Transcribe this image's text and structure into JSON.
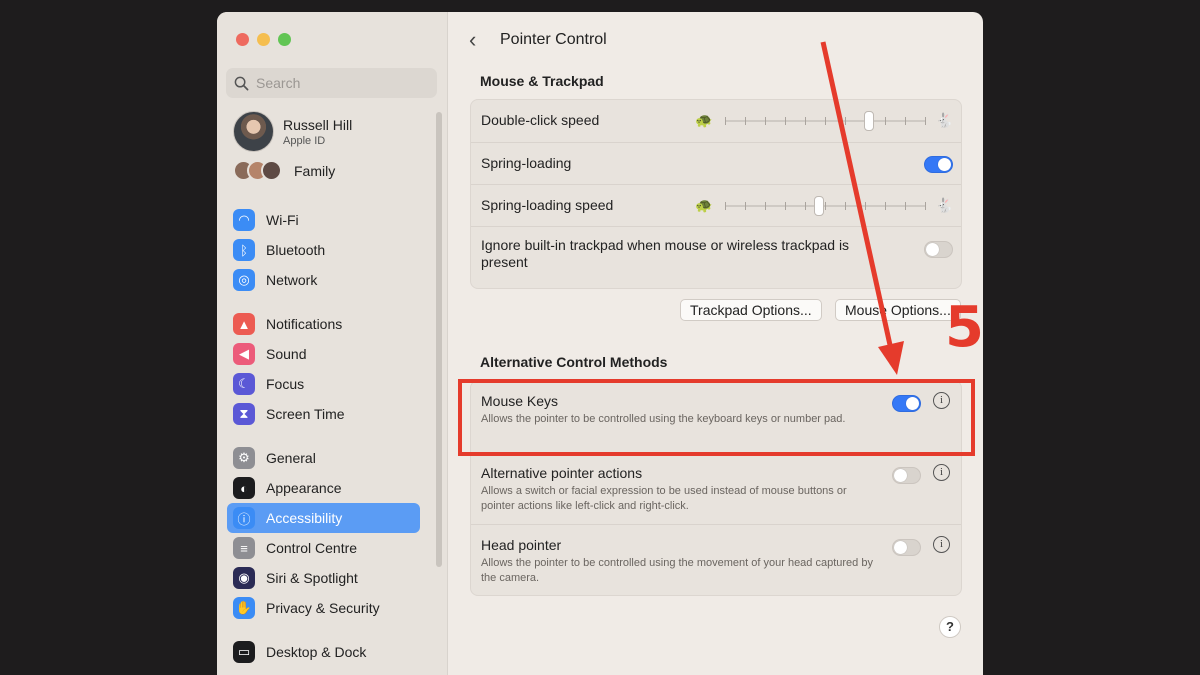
{
  "sidebar": {
    "search_placeholder": "Search",
    "user": {
      "name": "Russell Hill",
      "subtitle": "Apple ID"
    },
    "family_label": "Family",
    "groups": [
      [
        {
          "label": "Wi-Fi",
          "icon": "wifi-icon",
          "color": "#3b8cf5"
        },
        {
          "label": "Bluetooth",
          "icon": "bluetooth-icon",
          "color": "#3b8cf5"
        },
        {
          "label": "Network",
          "icon": "globe-icon",
          "color": "#3b8cf5"
        }
      ],
      [
        {
          "label": "Notifications",
          "icon": "bell-icon",
          "color": "#ec5b52"
        },
        {
          "label": "Sound",
          "icon": "speaker-icon",
          "color": "#ec5b7a"
        },
        {
          "label": "Focus",
          "icon": "moon-icon",
          "color": "#5b58d6"
        },
        {
          "label": "Screen Time",
          "icon": "hourglass-icon",
          "color": "#5b58d6"
        }
      ],
      [
        {
          "label": "General",
          "icon": "gear-icon",
          "color": "#8e8e93"
        },
        {
          "label": "Appearance",
          "icon": "appearance-icon",
          "color": "#1c1c1e"
        },
        {
          "label": "Accessibility",
          "icon": "accessibility-icon",
          "color": "#3b8cf5",
          "active": true
        },
        {
          "label": "Control Centre",
          "icon": "control-centre-icon",
          "color": "#8e8e93"
        },
        {
          "label": "Siri & Spotlight",
          "icon": "siri-icon",
          "color": "#2b2b55"
        },
        {
          "label": "Privacy & Security",
          "icon": "hand-icon",
          "color": "#3b8cf5"
        }
      ],
      [
        {
          "label": "Desktop & Dock",
          "icon": "dock-icon",
          "color": "#1c1c1e"
        }
      ]
    ]
  },
  "main": {
    "title": "Pointer Control",
    "mouse_trackpad": {
      "heading": "Mouse & Trackpad",
      "double_click_speed": {
        "label": "Double-click speed",
        "value": 0.72
      },
      "spring_loading": {
        "label": "Spring-loading",
        "on": true
      },
      "spring_loading_speed": {
        "label": "Spring-loading speed",
        "value": 0.47
      },
      "ignore_trackpad": {
        "label": "Ignore built-in trackpad when mouse or wireless trackpad is present",
        "on": false
      }
    },
    "buttons": {
      "trackpad_options": "Trackpad Options...",
      "mouse_options": "Mouse Options..."
    },
    "alternative": {
      "heading": "Alternative Control Methods",
      "items": [
        {
          "label": "Mouse Keys",
          "desc": "Allows the pointer to be controlled using the keyboard keys or number pad.",
          "on": true
        },
        {
          "label": "Alternative pointer actions",
          "desc": "Allows a switch or facial expression to be used instead of mouse buttons or pointer actions like left-click and right-click.",
          "on": false
        },
        {
          "label": "Head pointer",
          "desc": "Allows the pointer to be controlled using the movement of your head captured by the camera.",
          "on": false
        }
      ]
    },
    "help": "?"
  },
  "annotation": {
    "step_number": "5",
    "color": "#e53b2c"
  },
  "colors": {
    "accent": "#3478f6",
    "sidebar_active": "#5b9cf4"
  }
}
